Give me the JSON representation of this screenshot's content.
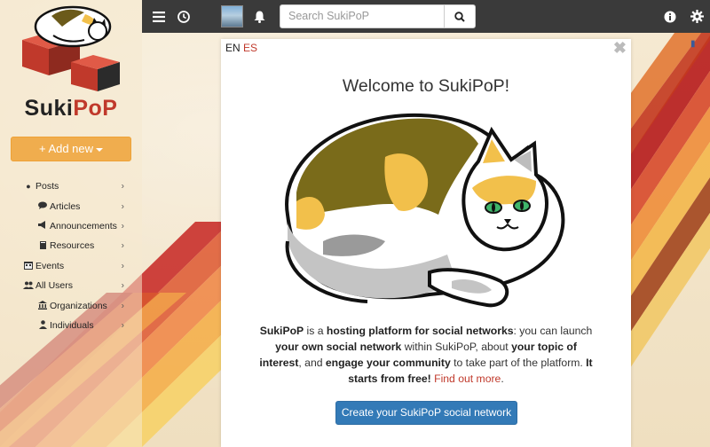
{
  "sidebar": {
    "brand_part1": "Suki",
    "brand_part2": "PoP",
    "add_new_label": "+ Add new",
    "items": [
      {
        "label": "Posts",
        "icon": "circle-icon"
      },
      {
        "label": "Articles",
        "icon": "comment-icon"
      },
      {
        "label": "Announcements",
        "icon": "bullhorn-icon"
      },
      {
        "label": "Resources",
        "icon": "book-icon"
      },
      {
        "label": "Events",
        "icon": "calendar-icon"
      },
      {
        "label": "All Users",
        "icon": "users-icon"
      },
      {
        "label": "Organizations",
        "icon": "bank-icon"
      },
      {
        "label": "Individuals",
        "icon": "user-icon"
      }
    ]
  },
  "topbar": {
    "search_placeholder": "Search SukiPoP"
  },
  "modal": {
    "lang_en": "EN",
    "lang_es": "ES",
    "close_glyph": "✖",
    "title": "Welcome to SukiPoP!",
    "desc": {
      "p1": "SukiPoP",
      "p2": " is a ",
      "p3": "hosting platform for social networks",
      "p4": ": you can launch ",
      "p5": "your own social network",
      "p6": " within SukiPoP, about ",
      "p7": "your topic of interest",
      "p8": ", and ",
      "p9": "engage your community",
      "p10": " to take part of the platform. ",
      "p11": "It starts from free!",
      "p12": " ",
      "link": "Find out more",
      "p13": "."
    },
    "cta_label": "Create your SukiPoP social network"
  },
  "colors": {
    "accent_orange": "#f0ad4e",
    "brand_red": "#c0392b",
    "primary_blue": "#337ab7",
    "topbar_dark": "#3a3a3a"
  }
}
